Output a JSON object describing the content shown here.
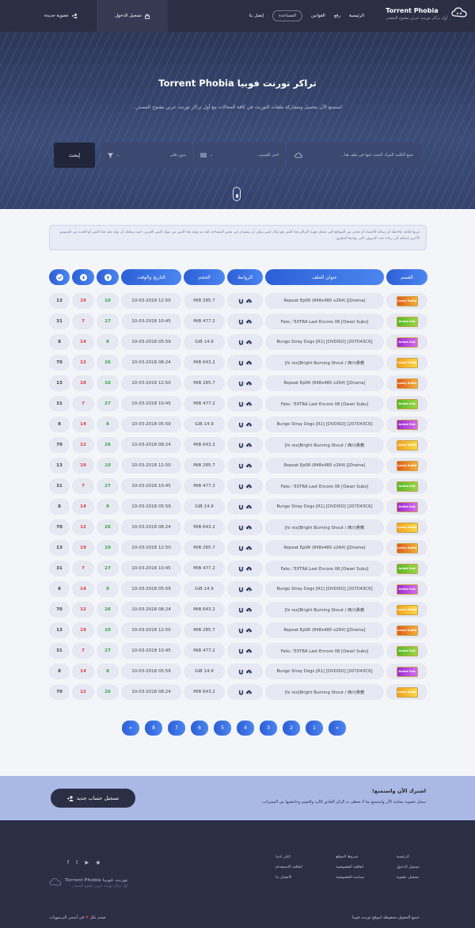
{
  "nav": {
    "brand_title": "Torrent Phobia",
    "brand_subtitle": "أول تراكر تورنت عربي مفتوح المصدر",
    "menu": [
      "الرئيسية",
      "رفع",
      "القوانين",
      "المساعدة",
      "إتصل بنا"
    ],
    "active_index": 3,
    "login": "تسجيل الدخول",
    "register": "عضوية جديدة"
  },
  "hero": {
    "title": "تراكر تورنت فوبيا Torrent Phobia",
    "subtitle": "استمتع الآن بتحميل ومشاركة ملفات التورنت في كافة المجالات مع أول تراكر تورنت عربي مفتوح المصدر..",
    "search_placeholder": "شيع الكلمة المراد البحث عنها في ملف هنا...",
    "section_select": "اختر القسم...",
    "filter_select": "بدون فلتر",
    "search_button": "إبحث"
  },
  "notice": "مربع لكتابة ملاحظة أو رسالة للأعضاء أو تحذير من المواقع التي تنتحل هوية التراكر هذا النص هو مثال لنص يمكن أن يستبدل في نفس المساحة، لقد تم توليد هذا النص من مولد النص العربى، حيث يمكنك أن تولد مثل هذا النص أو العديد من النصوص الأخرى إضافة إلى زيادة عدد الحروف التى يولدها التطبيق.",
  "table": {
    "headers": {
      "category": "القسم",
      "title": "عنوان الملف",
      "links": "الروابط",
      "size": "الحجم",
      "date": "التاريخ والوقت"
    },
    "rows": [
      {
        "cat": "drama",
        "cat_label": "Loony Radio",
        "title": "[JDrama] Repeat Ep06 (848x480 x264)",
        "size": "285.7 MiB",
        "date": "12:50 10-03-2018",
        "up": "10",
        "down": "19",
        "done": "13"
      },
      {
        "cat": "anime",
        "cat_label": "Anime Sub",
        "title": "[Owari Subs] Fate／EXTRA Last Encore 06",
        "size": "477.2 MiB",
        "date": "10:45 10-03-2018",
        "up": "27",
        "down": "7",
        "done": "31"
      },
      {
        "cat": "music",
        "cat_label": "Anime Sub",
        "title": "[207D43C6] [DVDISO] Bungo Stray Dogs [R1]",
        "size": "14.9 GiB",
        "date": "05:59 10-03-2018",
        "up": "8",
        "down": "14",
        "done": "8"
      },
      {
        "cat": "game",
        "cat_label": "Loony Radio",
        "title": "hi res]Bright Burning Shout / 西川貴教]",
        "size": "643.2 MiB",
        "date": "08:24 10-03-2018",
        "up": "26",
        "down": "12",
        "done": "70"
      },
      {
        "cat": "drama",
        "cat_label": "Loony Radio",
        "title": "[JDrama] Repeat Ep06 (848x480 x264)",
        "size": "285.7 MiB",
        "date": "12:50 10-03-2018",
        "up": "10",
        "down": "19",
        "done": "13"
      },
      {
        "cat": "anime",
        "cat_label": "Anime Sub",
        "title": "[Owari Subs] Fate／EXTRA Last Encore 06",
        "size": "477.2 MiB",
        "date": "10:45 10-03-2018",
        "up": "27",
        "down": "7",
        "done": "31"
      },
      {
        "cat": "music",
        "cat_label": "Anime Sub",
        "title": "[207D43C6] [DVDISO] Bungo Stray Dogs [R1]",
        "size": "14.9 GiB",
        "date": "05:59 10-03-2018",
        "up": "8",
        "down": "14",
        "done": "8"
      },
      {
        "cat": "game",
        "cat_label": "Loony Radio",
        "title": "hi res]Bright Burning Shout / 西川貴教]",
        "size": "643.2 MiB",
        "date": "08:24 10-03-2018",
        "up": "26",
        "down": "12",
        "done": "70"
      },
      {
        "cat": "drama",
        "cat_label": "Loony Radio",
        "title": "[JDrama] Repeat Ep06 (848x480 x264)",
        "size": "285.7 MiB",
        "date": "12:50 10-03-2018",
        "up": "10",
        "down": "19",
        "done": "13"
      },
      {
        "cat": "anime",
        "cat_label": "Anime Sub",
        "title": "[Owari Subs] Fate／EXTRA Last Encore 06",
        "size": "477.2 MiB",
        "date": "10:45 10-03-2018",
        "up": "27",
        "down": "7",
        "done": "31"
      },
      {
        "cat": "music",
        "cat_label": "Anime Sub",
        "title": "[207D43C6] [DVDISO] Bungo Stray Dogs [R1]",
        "size": "14.9 GiB",
        "date": "05:59 10-03-2018",
        "up": "8",
        "down": "14",
        "done": "8"
      },
      {
        "cat": "game",
        "cat_label": "Loony Radio",
        "title": "hi res]Bright Burning Shout / 西川貴教]",
        "size": "643.2 MiB",
        "date": "08:24 10-03-2018",
        "up": "26",
        "down": "12",
        "done": "70"
      },
      {
        "cat": "drama",
        "cat_label": "Loony Radio",
        "title": "[JDrama] Repeat Ep06 (848x480 x264)",
        "size": "285.7 MiB",
        "date": "12:50 10-03-2018",
        "up": "10",
        "down": "19",
        "done": "13"
      },
      {
        "cat": "anime",
        "cat_label": "Anime Sub",
        "title": "[Owari Subs] Fate／EXTRA Last Encore 06",
        "size": "477.2 MiB",
        "date": "10:45 10-03-2018",
        "up": "27",
        "down": "7",
        "done": "31"
      },
      {
        "cat": "music",
        "cat_label": "Anime Sub",
        "title": "[207D43C6] [DVDISO] Bungo Stray Dogs [R1]",
        "size": "14.9 GiB",
        "date": "05:59 10-03-2018",
        "up": "8",
        "down": "14",
        "done": "8"
      },
      {
        "cat": "game",
        "cat_label": "Loony Radio",
        "title": "hi res]Bright Burning Shout / 西川貴教]",
        "size": "643.2 MiB",
        "date": "08:24 10-03-2018",
        "up": "26",
        "down": "12",
        "done": "70"
      },
      {
        "cat": "drama",
        "cat_label": "Loony Radio",
        "title": "[JDrama] Repeat Ep06 (848x480 x264)",
        "size": "285.7 MiB",
        "date": "12:50 10-03-2018",
        "up": "10",
        "down": "19",
        "done": "13"
      },
      {
        "cat": "anime",
        "cat_label": "Anime Sub",
        "title": "[Owari Subs] Fate／EXTRA Last Encore 06",
        "size": "477.2 MiB",
        "date": "10:45 10-03-2018",
        "up": "27",
        "down": "7",
        "done": "31"
      },
      {
        "cat": "music",
        "cat_label": "Anime Sub",
        "title": "[207D43C6] [DVDISO] Bungo Stray Dogs [R1]",
        "size": "14.9 GiB",
        "date": "05:59 10-03-2018",
        "up": "8",
        "down": "14",
        "done": "8"
      },
      {
        "cat": "game",
        "cat_label": "Loony Radio",
        "title": "hi res]Bright Burning Shout / 西川貴教]",
        "size": "643.2 MiB",
        "date": "08:24 10-03-2018",
        "up": "26",
        "down": "12",
        "done": "70"
      }
    ]
  },
  "pagination": [
    "«",
    "8",
    "7",
    "6",
    "5",
    "4",
    "3",
    "2",
    "1",
    "»"
  ],
  "signup": {
    "title": "اشترك الآن واستمتع!",
    "text": "سجل عضوية مجانية الآن واستمتع بما لا يحظى به الزائر العادي كالرد والتقييم وخانصيها من المميزات.",
    "button": "تسجيل حساب جديد"
  },
  "footer": {
    "col1": [
      "الرئيسية",
      "تسجيل الدخول",
      "تسجيل عضوية"
    ],
    "col2": [
      "شروط الموقع",
      "اتفاقية الخصوصية",
      "سياسة الخصوصية"
    ],
    "col3": [
      "اعلن لدينا",
      "اتفاقية الاستخدام",
      "الاتصال بنا"
    ],
    "brand_title": "تورنت فوبيا Torrent Phobia",
    "brand_subtitle": "أول تراكر تورنت عربي مفتوح المصدر",
    "copyright": "جميع الحقوق محفوظة لموقع تورنت فوبيا",
    "made_by": "صمم بكل",
    "made_by_suffix": "في أسس اليرموويات"
  },
  "colors": {
    "accent": "#3b72e6",
    "dark": "#2b2f45",
    "red": "#e5383b",
    "green": "#2eaa3a"
  }
}
